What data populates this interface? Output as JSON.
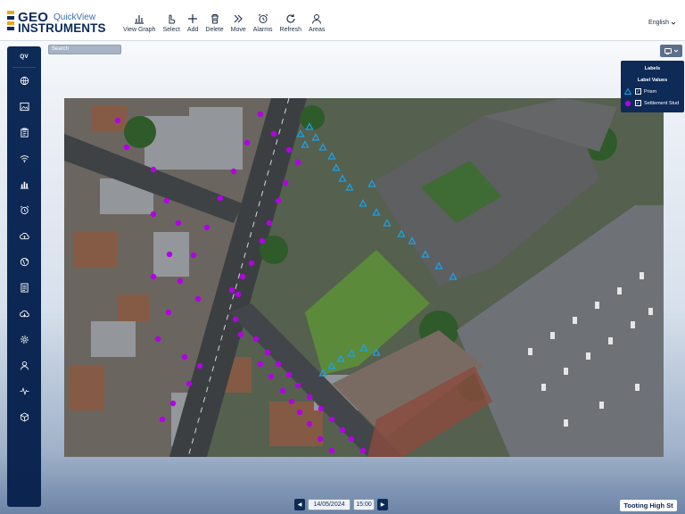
{
  "app": {
    "logo_top": "GEO",
    "logo_bottom": "INSTRUMENTS",
    "product": "QuickView",
    "language": "English"
  },
  "toolbar": [
    {
      "label": "View Graph",
      "icon": "bar-chart-icon"
    },
    {
      "label": "Select",
      "icon": "pointer-icon"
    },
    {
      "label": "Add",
      "icon": "plus-icon"
    },
    {
      "label": "Delete",
      "icon": "trash-icon"
    },
    {
      "label": "Move",
      "icon": "double-chevron-icon"
    },
    {
      "label": "Alarms",
      "icon": "alarm-clock-icon"
    },
    {
      "label": "Refresh",
      "icon": "refresh-icon"
    },
    {
      "label": "Areas",
      "icon": "person-area-icon"
    }
  ],
  "nav": {
    "header": "QV",
    "items": [
      "globe-icon",
      "image-icon",
      "clipboard-icon",
      "wifi-icon",
      "bar-chart-icon",
      "alarm-clock-icon",
      "cloud-upload-icon",
      "earth-icon",
      "document-icon",
      "cloud-download-icon",
      "gear-icon",
      "user-icon",
      "pulse-icon",
      "cube-icon"
    ]
  },
  "search": {
    "placeholder": "Search"
  },
  "layers": {
    "labels_label": "Labels",
    "label_values_label": "Label Values",
    "items": [
      {
        "name": "Prism",
        "symbol": "triangle",
        "color": "#1da1e8",
        "checked": true
      },
      {
        "name": "Settlement Stud",
        "symbol": "circle",
        "color": "#b300e6",
        "checked": true
      }
    ]
  },
  "datetime": {
    "date": "14/05/2024",
    "time": "15:00",
    "prev_icon": "arrow-left-icon",
    "next_icon": "arrow-right-icon"
  },
  "site": "Tooting High St",
  "colors": {
    "navy": "#0e2a57",
    "stud": "#b300e6",
    "prism": "#1da1e8"
  }
}
